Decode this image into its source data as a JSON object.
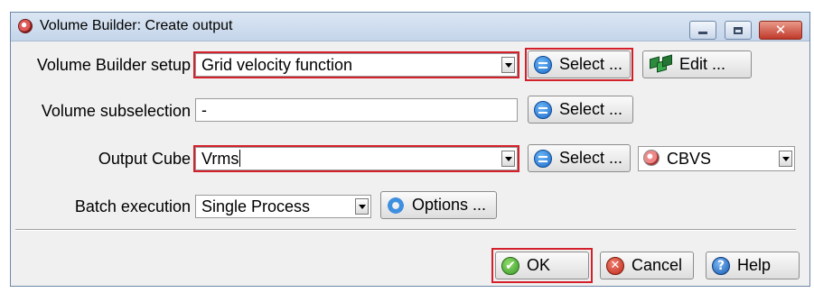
{
  "window": {
    "title": "Volume Builder: Create output",
    "controls": [
      "minimize-icon",
      "maximize-icon",
      "close-icon"
    ]
  },
  "setup": {
    "label": "Volume Builder setup",
    "value": "Grid velocity function",
    "select_label": "Select ...",
    "edit_label": "Edit ..."
  },
  "subselection": {
    "label": "Volume subselection",
    "value": "-",
    "select_label": "Select ..."
  },
  "output": {
    "label": "Output Cube",
    "value": "Vrms",
    "select_label": "Select ...",
    "format_value": "CBVS"
  },
  "batch": {
    "label": "Batch execution",
    "value": "Single Process",
    "options_label": "Options ..."
  },
  "footer": {
    "ok_label": "OK",
    "cancel_label": "Cancel",
    "help_label": "Help"
  },
  "colors": {
    "highlight": "#d4202a",
    "window_bg": "#f0f0f0",
    "titlebar": "#c4d5ea"
  }
}
